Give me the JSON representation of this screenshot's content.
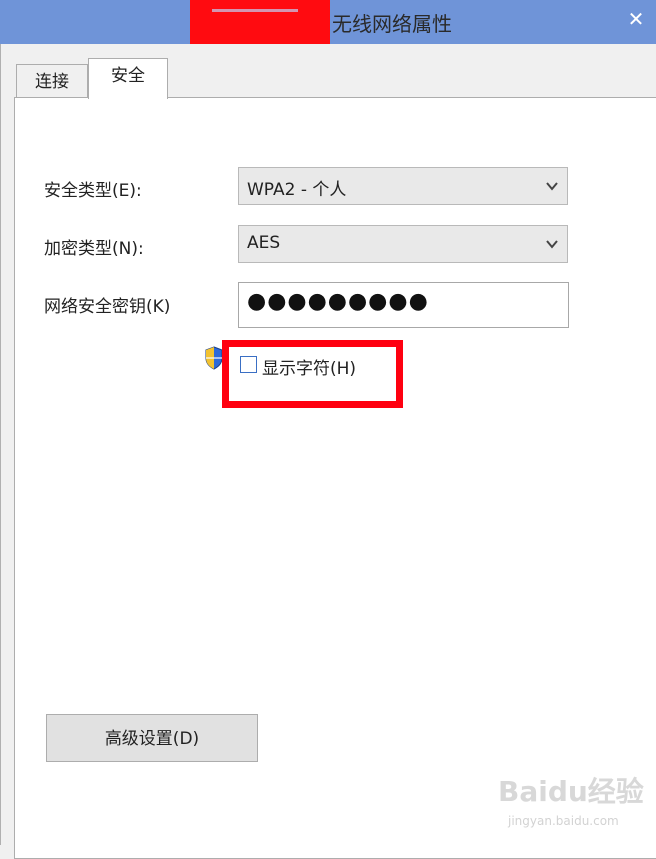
{
  "window": {
    "title": "无线网络属性",
    "close_glyph": "✕"
  },
  "tabs": [
    {
      "label": "连接",
      "active": false
    },
    {
      "label": "安全",
      "active": true
    }
  ],
  "security": {
    "type_label": "安全类型(E):",
    "type_value": "WPA2 - 个人",
    "encryption_label": "加密类型(N):",
    "encryption_value": "AES",
    "key_label": "网络安全密钥(K)",
    "key_value_masked": "●●●●●●●●●",
    "show_chars_label": "显示字符(H)",
    "show_chars_checked": false
  },
  "buttons": {
    "advanced_label": "高级设置(D)"
  },
  "watermark": {
    "brand": "Baidu经验",
    "url": "jingyan.baidu.com"
  },
  "colors": {
    "titlebar": "#6f94d8",
    "highlight_red": "#ff0010",
    "redaction_red": "#ff0b10"
  }
}
